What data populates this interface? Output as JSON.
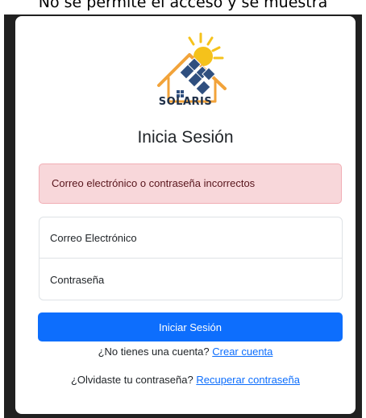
{
  "header": {
    "caption": "No se permite el acceso y se muestra"
  },
  "brand": {
    "name": "SOLARIS",
    "logo_icon": "solar-house-logo",
    "colors": {
      "roof": "#f2a33a",
      "sun": "#f5c21b",
      "panels": "#2f4f7f",
      "text": "#1f3049"
    }
  },
  "login": {
    "title": "Inicia Sesión",
    "error_message": "Correo electrónico o contraseña incorrectos",
    "email_placeholder": "Correo Electrónico",
    "email_value": "",
    "password_placeholder": "Contraseña",
    "password_value": "",
    "submit_label": "Iniciar Sesión",
    "signup_prompt": "¿No tienes una cuenta?",
    "signup_link": "Crear cuenta",
    "forgot_prompt": "¿Olvidaste tu contraseña?",
    "forgot_link": "Recuperar contraseña"
  },
  "theme": {
    "primary": "#0d6efd",
    "danger_bg": "#f8d7da",
    "danger_text": "#58151c"
  }
}
